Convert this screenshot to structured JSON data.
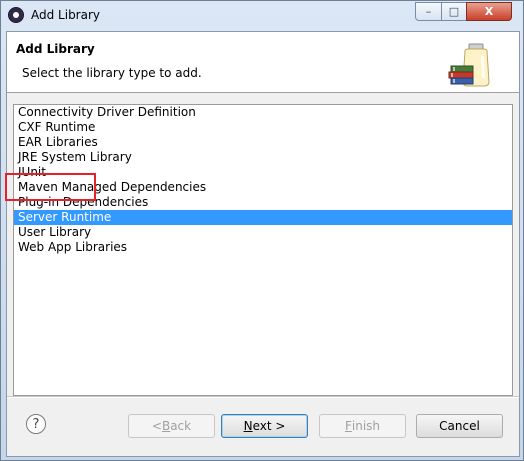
{
  "window": {
    "title": "Add Library",
    "min_label": "–",
    "max_label": "□",
    "close_label": "X"
  },
  "banner": {
    "title": "Add Library",
    "subtitle": "Select the library type to add."
  },
  "library_types": [
    "Connectivity Driver Definition",
    "CXF Runtime",
    "EAR Libraries",
    "JRE System Library",
    "JUnit",
    "Maven Managed Dependencies",
    "Plug-in Dependencies",
    "Server Runtime",
    "User Library",
    "Web App Libraries"
  ],
  "selected_index": 7,
  "buttons": {
    "help": "?",
    "back_prefix": "< ",
    "back_mnemonic": "B",
    "back_rest": "ack",
    "next_mnemonic": "N",
    "next_rest": "ext >",
    "finish_mnemonic": "F",
    "finish_rest": "inish",
    "cancel": "Cancel"
  },
  "colors": {
    "selection": "#3399ff",
    "highlight_box": "#e8202a"
  }
}
